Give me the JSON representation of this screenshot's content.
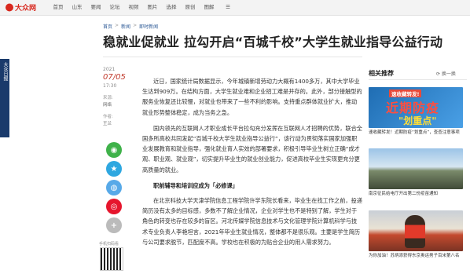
{
  "header": {
    "logo_text": "大众网",
    "nav": [
      "首页",
      "山东",
      "要闻",
      "论坛",
      "视频",
      "图片",
      "选择",
      "原创",
      "图解",
      "☰"
    ]
  },
  "breadcrumb": [
    "首页",
    "新闻",
    "即时新闻"
  ],
  "article": {
    "title": "稳就业促就业 拉勾开启“百城千校”大学生就业指导公益行动",
    "year": "2021",
    "date": "07/05",
    "time": "17:30",
    "source_label": "来源:",
    "source": "网络",
    "editor_label": "作者:",
    "editor": "王兰",
    "paragraphs": [
      "近日，国家统计局数据显示，今年城镇新增劳动力大概有1400多万，其中大学毕业生达到909万。在结构方面，大学生就业难和企业招工难是并存的。此外，部分接触型的服务业恢复还比较慢，对就业也带来了一些不利的影响。支持重点群体就业扩大，推动就业形势整体稳定，成为当务之急。",
      "国内领先的互联网人才职业成长平台拉勾充分发挥在互联网人才招聘的优势，联合全国多所高校共同发起“百城千校大学生就业指导公益行”，该行动为贯彻落实国家加强职业发展教育和就业指导，强化就业育人实效的部署要求，积极引导毕业生树立正确“成才观、职业观、就业观”，切实提升毕业生的就业创业能力，促进高校毕业生实现更充分更高质量的就业。",
      "在北京科技大学天津学院信息工程学院许学东院长看来，毕业生在找工作之前，投递简历没有太多的目标感，多数不了解企业情况，企业对学生也不是特别了解，学生对于角色的转变也存在较多的盲区。河北传媒学院信息技术与文化管理学院计算机科学与技术专业负责人李艳坦言，2021年毕业生就业情况，整体都不是很乐观。主要是学生简历与公司要求脱节，匹配度不高。学校也在积极的为贴合企业的用人需求努力。"
    ],
    "subheading": "职前辅导和培训应成为「必修课」"
  },
  "share": {
    "qr_label": "手机扫码看"
  },
  "sidebar": {
    "heading": "相关推荐",
    "switch_label": "⟳ 换一换",
    "cards": [
      {
        "tag": "速收藏转发!",
        "big_a": "近期",
        "big_b": "防疫",
        "small": "\"划重点\"",
        "caption": "速收藏转发！近期防疫“划重点”，查查注意事项"
      },
      {
        "caption": "南京征民给电厅开出第二份疫苗通知"
      },
      {
        "caption": "为你加油！苏炳添获得东京奥运男子百米第八名"
      }
    ]
  },
  "left_banner": "大众日报"
}
